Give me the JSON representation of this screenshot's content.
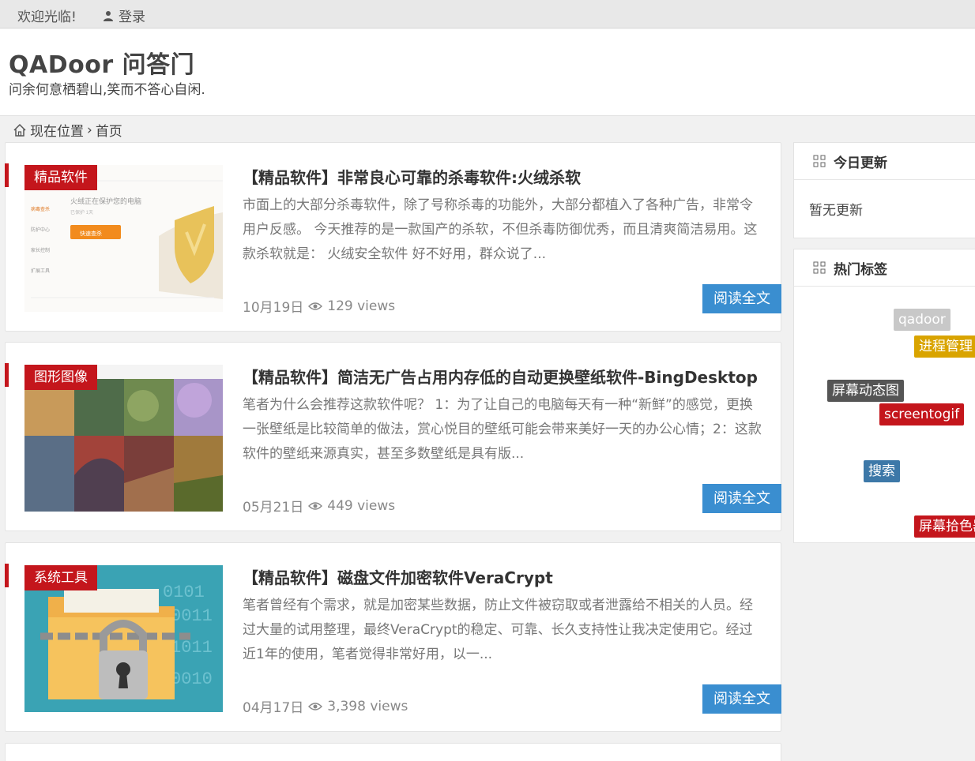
{
  "topbar": {
    "welcome": "欢迎光临!",
    "login": "登录"
  },
  "header": {
    "site_title": "QADoor 问答门",
    "tagline": "问余何意栖碧山,笑而不答心自闲."
  },
  "breadcrumb": {
    "label": "现在位置",
    "separator": "›",
    "current": "首页"
  },
  "posts": [
    {
      "category": "精品软件",
      "title": "【精品软件】非常良心可靠的杀毒软件:火绒杀软",
      "excerpt": "市面上的大部分杀毒软件，除了号称杀毒的功能外，大部分都植入了各种广告，非常令用户反感。 今天推荐的是一款国产的杀软，不但杀毒防御优秀，而且清爽简洁易用。这款杀软就是： 火绒安全软件 好不好用，群众说了...",
      "date": "10月19日",
      "views": "129 views",
      "read_more": "阅读全文",
      "thumb_text": {
        "heading": "火绒正在保护您的电脑",
        "sub": "已保护 1天",
        "button": "快速查杀",
        "menu": [
          "病毒查杀",
          "防护中心",
          "家长控制",
          "扩展工具"
        ]
      }
    },
    {
      "category": "图形图像",
      "title": "【精品软件】简洁无广告占用内存低的自动更换壁纸软件-BingDesktop",
      "excerpt": "笔者为什么会推荐这款软件呢？ 1：为了让自己的电脑每天有一种“新鲜”的感觉，更换一张壁纸是比较简单的做法，赏心悦目的壁纸可能会带来美好一天的办公心情；2：这款软件的壁纸来源真实，甚至多数壁纸是具有版...",
      "date": "05月21日",
      "views": "449 views",
      "read_more": "阅读全文"
    },
    {
      "category": "系统工具",
      "title": "【精品软件】磁盘文件加密软件VeraCrypt",
      "excerpt": "笔者曾经有个需求，就是加密某些数据，防止文件被窃取或者泄露给不相关的人员。经过大量的试用整理，最终VeraCrypt的稳定、可靠、长久支持性让我决定使用它。经过近1年的使用，笔者觉得非常好用，以一...",
      "date": "04月17日",
      "views": "3,398 views",
      "read_more": "阅读全文"
    }
  ],
  "sidebar": {
    "today": {
      "title": "今日更新",
      "empty_text": "暂无更新"
    },
    "hot_tags": {
      "title": "热门标签",
      "tags": [
        {
          "label": "qadoor",
          "color": "#c8c8c8"
        },
        {
          "label": "进程管理",
          "color": "#d9a400"
        },
        {
          "label": "屏幕动态图",
          "color": "#555555"
        },
        {
          "label": "screentogif",
          "color": "#c4161c"
        },
        {
          "label": "搜索",
          "color": "#3d78a8"
        },
        {
          "label": "屏幕拾色器",
          "color": "#c4161c"
        }
      ]
    }
  }
}
